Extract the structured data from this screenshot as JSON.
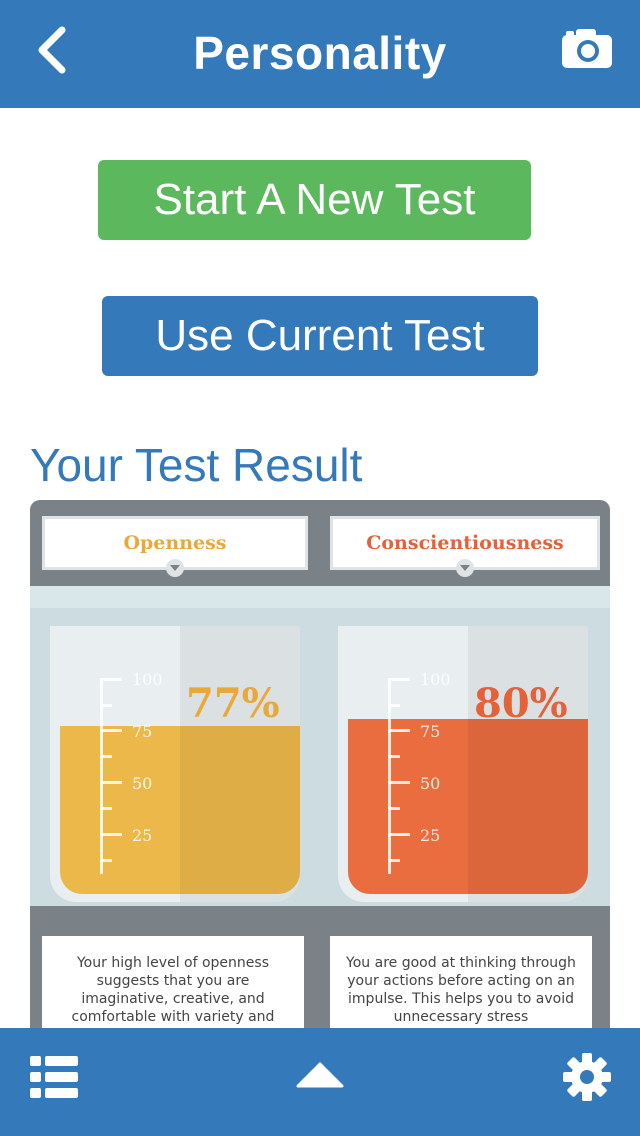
{
  "header": {
    "title": "Personality"
  },
  "actions": {
    "start_new_test": "Start A New Test",
    "use_current_test": "Use Current Test"
  },
  "result_heading": "Your Test Result",
  "traits": [
    {
      "name": "Openness",
      "percent_label": "77%",
      "percent_value": 77,
      "color": "#e8a93a",
      "liquid_color": "#ecb84a",
      "scale": [
        "100",
        "75",
        "50",
        "25"
      ],
      "description": "Your high level of openness suggests that you are imaginative, creative, and comfortable with variety and"
    },
    {
      "name": "Conscientiousness",
      "percent_label": "80%",
      "percent_value": 80,
      "color": "#e4623a",
      "liquid_color": "#ea6d40",
      "scale": [
        "100",
        "75",
        "50",
        "25"
      ],
      "description": "You are good at thinking through your actions before acting on an impulse. This helps you to avoid unnecessary stress"
    }
  ],
  "icons": {
    "back": "chevron-left-icon",
    "camera": "camera-icon",
    "list": "list-icon",
    "up": "triangle-up-icon",
    "settings": "gear-icon"
  },
  "colors": {
    "brand": "#3479b9",
    "success": "#5cb85c"
  }
}
